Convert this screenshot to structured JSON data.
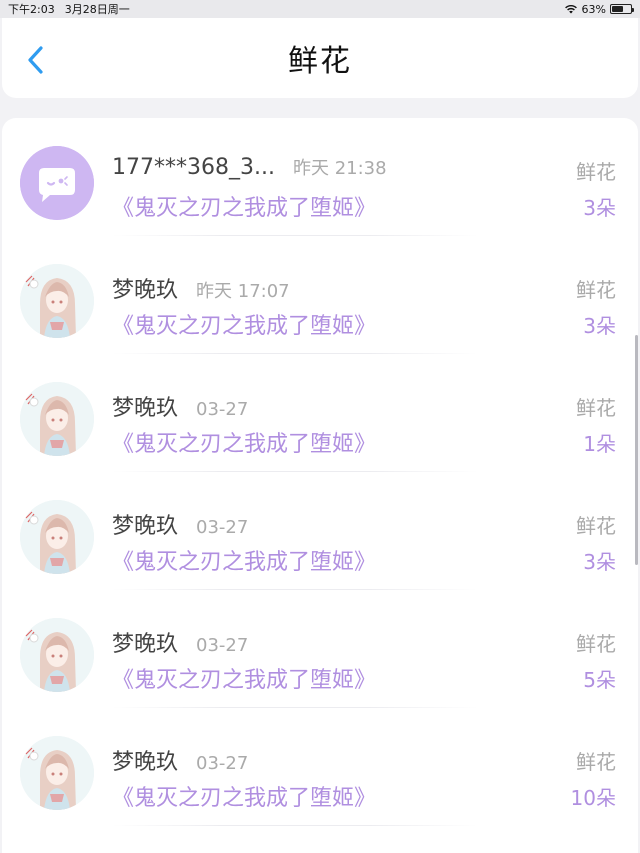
{
  "status_bar": {
    "time": "下午2:03",
    "date": "3月28日周一",
    "battery_text": "63%",
    "battery_level": 0.63
  },
  "header": {
    "title": "鲜花"
  },
  "items": [
    {
      "name": "177***368_3...",
      "time": "昨天 21:38",
      "book": "《鬼灭之刃之我成了堕姬》",
      "type": "鲜花",
      "count": "3朵",
      "avatar": "default"
    },
    {
      "name": "梦晚玖",
      "time": "昨天 17:07",
      "book": "《鬼灭之刃之我成了堕姬》",
      "type": "鲜花",
      "count": "3朵",
      "avatar": "anime"
    },
    {
      "name": "梦晚玖",
      "time": "03-27",
      "book": "《鬼灭之刃之我成了堕姬》",
      "type": "鲜花",
      "count": "1朵",
      "avatar": "anime"
    },
    {
      "name": "梦晚玖",
      "time": "03-27",
      "book": "《鬼灭之刃之我成了堕姬》",
      "type": "鲜花",
      "count": "3朵",
      "avatar": "anime"
    },
    {
      "name": "梦晚玖",
      "time": "03-27",
      "book": "《鬼灭之刃之我成了堕姬》",
      "type": "鲜花",
      "count": "5朵",
      "avatar": "anime"
    },
    {
      "name": "梦晚玖",
      "time": "03-27",
      "book": "《鬼灭之刃之我成了堕姬》",
      "type": "鲜花",
      "count": "10朵",
      "avatar": "anime"
    }
  ],
  "colors": {
    "accent": "#b08fe0",
    "back_arrow": "#2f9cf0",
    "default_avatar": "#ceb7f2"
  }
}
